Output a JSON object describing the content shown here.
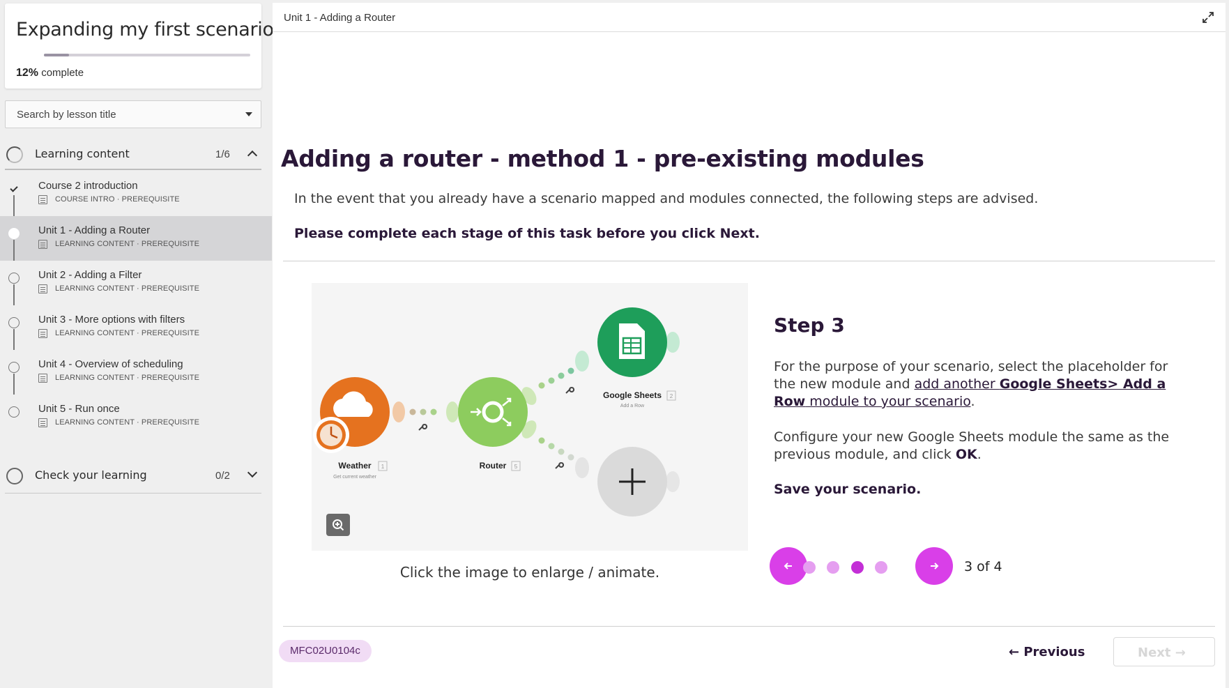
{
  "course": {
    "title": "Expanding my first scenario",
    "progress_percent": "12%",
    "progress_value": 12,
    "progress_suffix": "complete"
  },
  "search": {
    "placeholder": "Search by lesson title"
  },
  "sections": [
    {
      "label": "Learning content",
      "count": "1/6",
      "expanded": true
    },
    {
      "label": "Check your learning",
      "count": "0/2",
      "expanded": false
    }
  ],
  "lessons": [
    {
      "title": "Course 2 introduction",
      "meta": "COURSE INTRO · PREREQUISITE",
      "status": "done"
    },
    {
      "title": "Unit 1 - Adding a Router",
      "meta": "LEARNING CONTENT · PREREQUISITE",
      "status": "active"
    },
    {
      "title": "Unit 2 - Adding a Filter",
      "meta": "LEARNING CONTENT · PREREQUISITE",
      "status": "todo"
    },
    {
      "title": "Unit 3 - More options with filters",
      "meta": "LEARNING CONTENT · PREREQUISITE",
      "status": "todo"
    },
    {
      "title": "Unit 4 - Overview of scheduling",
      "meta": "LEARNING CONTENT · PREREQUISITE",
      "status": "todo"
    },
    {
      "title": "Unit 5 - Run once",
      "meta": "LEARNING CONTENT · PREREQUISITE",
      "status": "todo"
    }
  ],
  "main": {
    "breadcrumb": "Unit 1 - Adding a Router",
    "heading": "Adding a router - method 1 - pre-existing modules",
    "intro": "In the event that you already have a scenario mapped and modules connected, the following steps are advised.",
    "instruction": "Please complete each stage of this task before you click Next.",
    "diagram": {
      "weather_label": "Weather",
      "weather_sub": "Get current weather",
      "weather_badge": "1",
      "router_label": "Router",
      "router_badge": "5",
      "sheets_label": "Google Sheets",
      "sheets_sub": "Add a Row",
      "sheets_badge": "2"
    },
    "caption": "Click the image to enlarge / animate.",
    "step": {
      "title": "Step 3",
      "p1_a": "For the purpose of your scenario, select the placeholder for the new module and ",
      "p1_link1": "add another ",
      "p1_link_bold": "Google Sheets> Add a Row",
      "p1_link2": " module to your scenario",
      "p1_end": ".",
      "p2_a": "Configure your new Google Sheets module the same as the previous module, and click ",
      "p2_bold": "OK",
      "p2_end": ".",
      "p3": "Save your scenario."
    },
    "carousel": {
      "current": 3,
      "total": 4,
      "label": "3 of 4"
    },
    "lesson_code": "MFC02U0104c",
    "previous_label": "← Previous",
    "next_label": "Next →"
  },
  "colors": {
    "accent": "#d93fe8",
    "accent_dark": "#c32fd6",
    "heading": "#2a1838",
    "weather": "#e5721f",
    "router": "#8dcc5e",
    "sheets": "#1e9e5a"
  },
  "icons": [
    "check-icon",
    "document-icon",
    "chevron-up-icon",
    "chevron-down-icon",
    "expand-icon",
    "zoom-in-icon",
    "arrow-left-icon",
    "arrow-right-icon",
    "wrench-icon",
    "plus-icon"
  ]
}
